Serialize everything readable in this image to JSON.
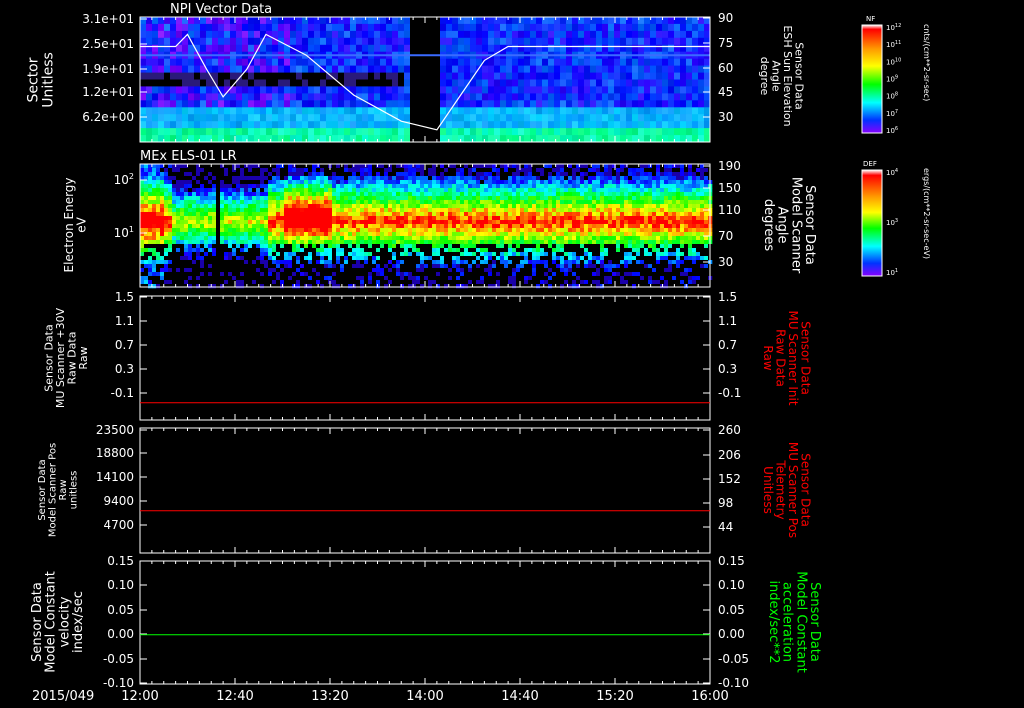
{
  "date_label": "2015/049",
  "x_ticks": [
    "12:00",
    "12:40",
    "13:20",
    "14:00",
    "14:40",
    "15:20",
    "16:00"
  ],
  "colors": {
    "background": "#000000",
    "axis": "#ffffff",
    "red_trace": "#ff0000",
    "green_trace": "#00ff00"
  },
  "panels": [
    {
      "id": "npi",
      "title": "NPI Vector Data",
      "left_label": [
        "Sector",
        "Unitless"
      ],
      "left_ticks": [
        "3.1e+01",
        "2.5e+01",
        "1.9e+01",
        "1.2e+01",
        "6.2e+00"
      ],
      "right_label": [
        "Sensor Data",
        "ESH Sun Elevation",
        "Angle",
        "degree"
      ],
      "right_label_color": "#ffffff",
      "right_ticks": [
        "90",
        "75",
        "60",
        "45",
        "30"
      ],
      "colorbar": {
        "title": "NF",
        "units": "cnts/(cm**2-sr-sec)",
        "tick_mantissa": [
          "10",
          "10",
          "10",
          "10",
          "10",
          "10",
          "10"
        ],
        "tick_exponents": [
          "12",
          "11",
          "10",
          "9",
          "8",
          "7",
          "6"
        ]
      }
    },
    {
      "id": "els",
      "title": "MEx ELS-01 LR",
      "left_label": [
        "Electron Energy",
        "eV"
      ],
      "left_ticks": [
        "10",
        "10"
      ],
      "left_tick_exponents": [
        "2",
        "1"
      ],
      "right_label": [
        "Sensor Data",
        "Model Scanner",
        "Angle",
        "degrees"
      ],
      "right_label_color": "#ffffff",
      "right_ticks": [
        "190",
        "150",
        "110",
        "70",
        "30"
      ],
      "colorbar": {
        "title": "DEF",
        "units": "ergs/(cm**2-sr-sec-eV)",
        "tick_mantissa": [
          "10",
          "10",
          "10"
        ],
        "tick_exponents": [
          "4",
          "3",
          "1"
        ]
      }
    },
    {
      "id": "mu30",
      "left_label": [
        "Sensor Data",
        "MU Scanner +30V",
        "Raw Data",
        "Raw"
      ],
      "left_ticks": [
        "1.5",
        "1.1",
        "0.7",
        "0.3",
        "-0.1"
      ],
      "right_label": [
        "Sensor Data",
        "MU Scanner Init",
        "Raw Data",
        "Raw"
      ],
      "right_label_color": "#ff0000",
      "right_ticks": [
        "1.5",
        "1.1",
        "0.7",
        "0.3",
        "-0.1"
      ]
    },
    {
      "id": "pos",
      "left_label": [
        "Sensor Data",
        "Model Scanner Pos",
        "Raw",
        "unitless"
      ],
      "left_ticks": [
        "23500",
        "18800",
        "14100",
        "9400",
        "4700"
      ],
      "right_label": [
        "Sensor Data",
        "MU Scanner Pos",
        "Telemetry",
        "Unitless"
      ],
      "right_label_color": "#ff0000",
      "right_ticks": [
        "260",
        "206",
        "152",
        "98",
        "44"
      ]
    },
    {
      "id": "const",
      "left_label": [
        "Sensor Data",
        "Model Constant",
        "velocity",
        "index/sec"
      ],
      "left_ticks": [
        "0.15",
        "0.10",
        "0.05",
        "0.00",
        "-0.05",
        "-0.10"
      ],
      "right_label": [
        "Sensor Data",
        "Model Constant",
        "acceleration",
        "index/sec**2"
      ],
      "right_label_color": "#00ff00",
      "right_ticks": [
        "0.15",
        "0.10",
        "0.05",
        "0.00",
        "-0.05",
        "-0.10"
      ]
    }
  ],
  "chart_data": [
    {
      "type": "heatmap",
      "title": "NPI Vector Data",
      "x": [
        "12:00",
        "12:40",
        "13:20",
        "14:00",
        "14:40",
        "15:20",
        "16:00"
      ],
      "ylabel": "Sector Unitless",
      "ylim": [
        0,
        31
      ],
      "data_gap": [
        "13:55",
        "14:05"
      ],
      "overlay_series": [
        {
          "name": "Sensor Data ESH Sun Elevation Angle",
          "axis": "right",
          "ylim": [
            18,
            90
          ],
          "x": [
            "12:00",
            "12:15",
            "12:20",
            "12:28",
            "12:35",
            "12:45",
            "12:53",
            "13:10",
            "13:30",
            "13:50",
            "14:05",
            "14:15",
            "14:25",
            "14:35",
            "16:00"
          ],
          "values": [
            73,
            73,
            80,
            60,
            44,
            60,
            80,
            68,
            45,
            30,
            25,
            45,
            65,
            73,
            73
          ]
        }
      ]
    },
    {
      "type": "heatmap",
      "title": "MEx ELS-01 LR",
      "x": [
        "12:00",
        "12:40",
        "13:20",
        "14:00",
        "14:40",
        "15:20",
        "16:00"
      ],
      "ylabel": "Electron Energy eV",
      "yscale": "log",
      "overlay_series": [
        {
          "name": "Sensor Data Model Scanner Angle",
          "axis": "right",
          "ylim": [
            10,
            190
          ],
          "x": [
            "12:00",
            "16:00"
          ],
          "values": [
            10,
            10
          ]
        }
      ]
    },
    {
      "type": "line",
      "x": [
        "12:00",
        "16:00"
      ],
      "ylim": [
        -0.3,
        1.5
      ],
      "series": [
        {
          "name": "Sensor Data MU Scanner Init Raw Data Raw",
          "axis": "right",
          "color": "#ff0000",
          "values": [
            -0.05,
            -0.05
          ]
        }
      ]
    },
    {
      "type": "line",
      "x": [
        "12:00",
        "16:00"
      ],
      "ylim": [
        0,
        23500
      ],
      "right_ylim": [
        0,
        260
      ],
      "series": [
        {
          "name": "Sensor Data MU Scanner Pos Telemetry Unitless",
          "axis": "right",
          "color": "#ff0000",
          "values": [
            88,
            88
          ]
        }
      ]
    },
    {
      "type": "line",
      "x": [
        "12:00",
        "16:00"
      ],
      "ylim": [
        -0.1,
        0.15
      ],
      "series": [
        {
          "name": "Sensor Data Model Constant acceleration index/sec**2",
          "axis": "right",
          "color": "#00ff00",
          "values": [
            0.0,
            0.0
          ]
        }
      ]
    }
  ]
}
